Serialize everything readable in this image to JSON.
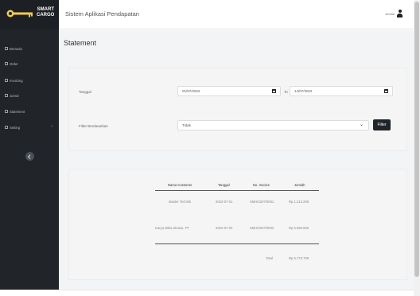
{
  "brand": {
    "line1": "SMART",
    "line2": "CARGO"
  },
  "header": {
    "app_title": "Sistem Aplikasi Pendapatan",
    "user_name": "Jemmi"
  },
  "sidebar": {
    "items": [
      {
        "label": "Beranda"
      },
      {
        "label": "Order"
      },
      {
        "label": "Invoicing"
      },
      {
        "label": "Jurnal"
      },
      {
        "label": "Statement"
      },
      {
        "label": "Setting"
      }
    ]
  },
  "page": {
    "title": "Statement"
  },
  "filters": {
    "date_label": "Tanggal",
    "date_from": "01/07/2022",
    "to_label": "To",
    "date_to": "14/07/2022",
    "filter_by_label": "Filter Berdasarkan",
    "filter_by_value": "Tidak",
    "filter_button": "Filter"
  },
  "table": {
    "headers": [
      "Nama Customer",
      "Tanggal",
      "No. Invoice",
      "Jumlah"
    ],
    "rows": [
      [
        "Master Technik",
        "2022-07-01",
        "SMH/2207/0001",
        "Rp 1.213.200"
      ],
      [
        "Karya Mitra Sinaus, PT",
        "2022-07-04",
        "SMH/2207/0002",
        "Rp 5.560.500"
      ]
    ],
    "total_label": "Total",
    "total_value": "Rp 6.773.700"
  }
}
